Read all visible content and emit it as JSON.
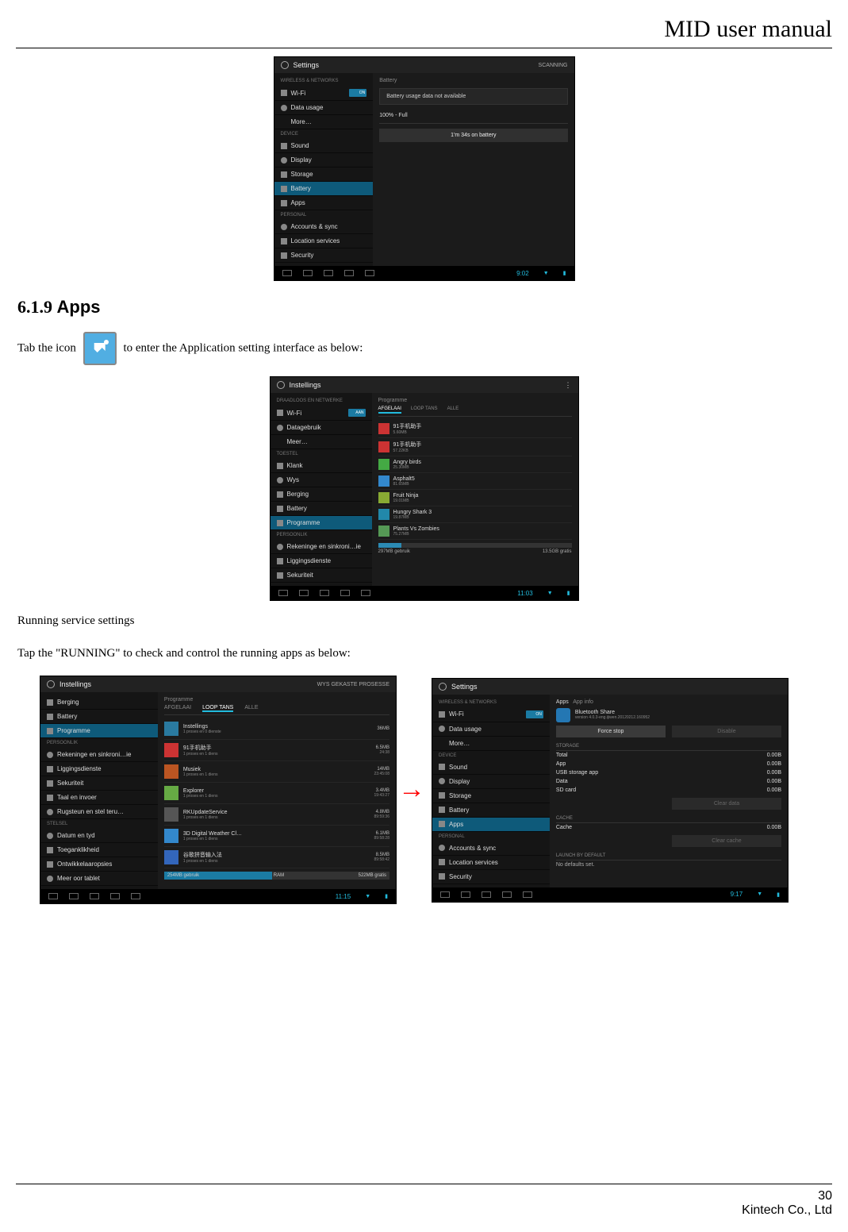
{
  "doc": {
    "header": "MID user manual",
    "page_number": "30",
    "company": "Kintech Co., Ltd",
    "heading_num": "6.1.9 ",
    "heading_text": "Apps",
    "p1a": "Tab the icon ",
    "p1b": " to enter the Application setting interface as below:",
    "p2": "Running service settings",
    "p3": "Tap the \"RUNNING\" to check and control the running apps as below:"
  },
  "shot1": {
    "title": "Settings",
    "scan": "SCANNING",
    "cat1": "WIRELESS & NETWORKS",
    "wifi": "Wi-Fi",
    "wifion": "ON",
    "datausage": "Data usage",
    "more": "More…",
    "cat2": "DEVICE",
    "sound": "Sound",
    "display": "Display",
    "storage": "Storage",
    "battery": "Battery",
    "apps": "Apps",
    "cat3": "PERSONAL",
    "accounts": "Accounts & sync",
    "location": "Location services",
    "security": "Security",
    "content_title": "Battery",
    "not_avail": "Battery usage data not available",
    "full": "100% - Full",
    "onbatt": "1'm 34s on battery",
    "clock": "9:02"
  },
  "shot2": {
    "title": "Instellings",
    "cat1": "DRAADLOOS EN NETWERKE",
    "wifi": "Wi-Fi",
    "wifion": "AAN",
    "datausage": "Datagebruik",
    "more": "Meer…",
    "cat2": "TOESTEL",
    "klank": "Klank",
    "wys": "Wys",
    "berging": "Berging",
    "battery": "Battery",
    "programme": "Programme",
    "cat3": "PERSOONLIK",
    "rek": "Rekeninge en sinkroni…ie",
    "lig": "Liggingsdienste",
    "sek": "Sekuriteit",
    "content_title": "Programme",
    "tab1": "AFGELAAI",
    "tab2": "LOOP TANS",
    "tab3": "ALLE",
    "a1": "91手机助手",
    "a1s": "5.60MB",
    "a2": "91手机助手",
    "a2s": "57.22KB",
    "a3": "Angry birds",
    "a3s": "25.30MB",
    "a4": "Asphalt5",
    "a4s": "81.65MB",
    "a5": "Fruit Ninja",
    "a5s": "19.01MB",
    "a6": "Hungry Shark 3",
    "a6s": "19.87MB",
    "a7": "Plants Vs Zombies",
    "a7s": "75.27MB",
    "storage_left": "297MB gebruik",
    "storage_right": "13.5GB gratis",
    "clock": "11:03"
  },
  "shot3": {
    "title": "Instellings",
    "topright": "WYS GEKASTE PROSESSE",
    "side": {
      "berging": "Berging",
      "battery": "Battery",
      "programme": "Programme",
      "cat3": "PERSOONLIK",
      "rek": "Rekeninge en sinkroni…ie",
      "lig": "Liggingsdienste",
      "sek": "Sekuriteit",
      "taal": "Taal en invoer",
      "rug": "Rugsteun en stel teru…",
      "cat4": "STELSEL",
      "datum": "Datum en tyd",
      "toe": "Toeganklikheid",
      "ont": "Ontwikkelaaropsies",
      "meer": "Meer oor tablet"
    },
    "content_title": "Programme",
    "tab1": "AFGELAAI",
    "tab2": "LOOP TANS",
    "tab3": "ALLE",
    "p1": {
      "n": "Instellings",
      "s": "1 proses en 0 dienste",
      "m": "36MB",
      "t": ""
    },
    "p2": {
      "n": "91手机助手",
      "s": "1 proses en 1 diens",
      "m": "6.5MB",
      "t": "24:38"
    },
    "p3": {
      "n": "Musiek",
      "s": "1 proses en 1 diens",
      "m": "14MB",
      "t": "23:45:08"
    },
    "p4": {
      "n": "Explorer",
      "s": "1 proses en 1 diens",
      "m": "3.4MB",
      "t": "19:43:27"
    },
    "p5": {
      "n": "RKUpdateService",
      "s": "1 proses en 1 diens",
      "m": "4.8MB",
      "t": "89:59:36"
    },
    "p6": {
      "n": "3D Digital Weather Cl…",
      "s": "1 proses en 1 diens",
      "m": "6.1MB",
      "t": "89:58:28"
    },
    "p7": {
      "n": "谷歌拼音输入法",
      "s": "1 proses en 1 diens",
      "m": "8.5MB",
      "t": "89:58:42"
    },
    "ram_l": "254MB gebruik",
    "ram_c": "RAM",
    "ram_r": "522MB gratis",
    "clock": "11:15"
  },
  "shot4": {
    "title": "Settings",
    "cat1": "WIRELESS & NETWORKS",
    "wifi": "Wi-Fi",
    "wifion": "ON",
    "datausage": "Data usage",
    "more": "More…",
    "cat2": "DEVICE",
    "sound": "Sound",
    "display": "Display",
    "storage": "Storage",
    "battery": "Battery",
    "apps": "Apps",
    "cat3": "PERSONAL",
    "accounts": "Accounts & sync",
    "location": "Location services",
    "security": "Security",
    "crumb1": "Apps",
    "crumb2": "App info",
    "appname": "Bluetooth Share",
    "appver": "version 4.0.3-eng.ijiwen.20120212.160952",
    "btn1": "Force stop",
    "btn2": "Disable",
    "sect_storage": "STORAGE",
    "kv_total": "Total",
    "kv_total_v": "0.00B",
    "kv_app": "App",
    "kv_app_v": "0.00B",
    "kv_usb": "USB storage app",
    "kv_usb_v": "0.00B",
    "kv_data": "Data",
    "kv_data_v": "0.00B",
    "kv_sd": "SD card",
    "kv_sd_v": "0.00B",
    "btn3": "Clear data",
    "sect_cache": "CACHE",
    "kv_cache": "Cache",
    "kv_cache_v": "0.00B",
    "btn4": "Clear cache",
    "sect_launch": "LAUNCH BY DEFAULT",
    "launch_text": "No defaults set.",
    "clock": "9:17"
  }
}
